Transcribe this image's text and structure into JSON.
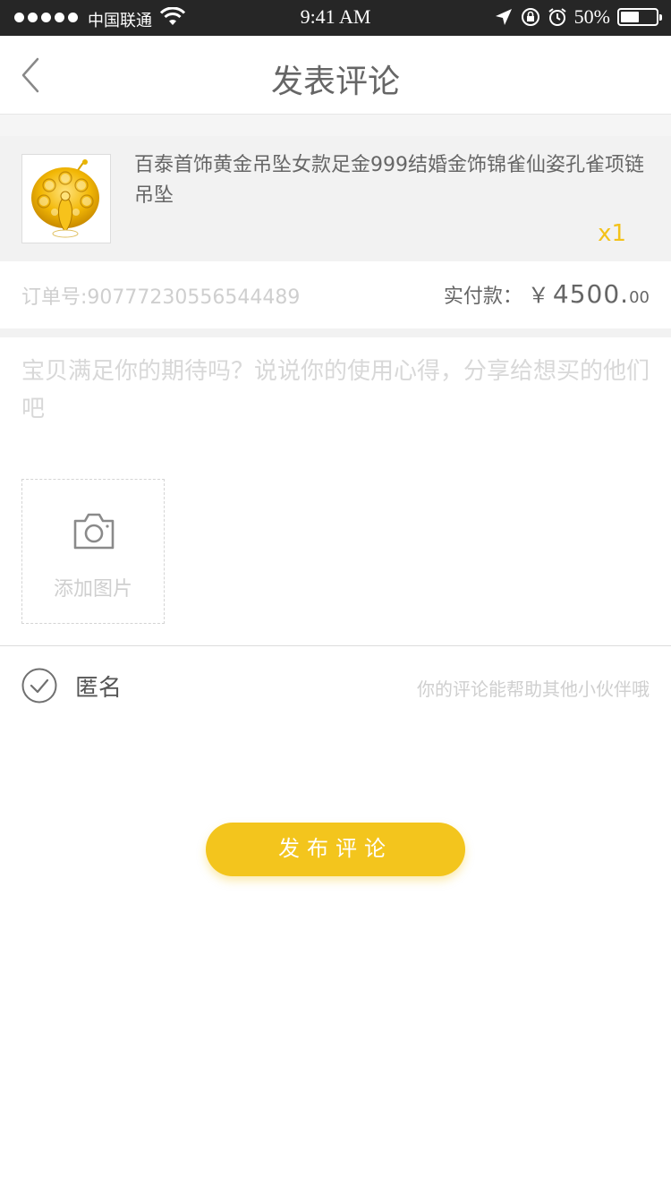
{
  "status_bar": {
    "carrier": "中国联通",
    "time": "9:41 AM",
    "battery": "50%",
    "battery_level": 0.5
  },
  "nav": {
    "title": "发表评论",
    "back_icon": "chevron-left-icon"
  },
  "product": {
    "name": "百泰首饰黄金吊坠女款足金999结婚金饰锦雀仙姿孔雀项链吊坠",
    "quantity": "x1",
    "image_icon": "gold-peacock-pendant-image"
  },
  "order": {
    "order_no": "订单号:90777230556544489",
    "pay_label": "实付款：",
    "currency": "￥",
    "amount_int": "4500.",
    "amount_dec": "00"
  },
  "review": {
    "placeholder": "宝贝满足你的期待吗？说说你的使用心得，分享给想买的他们吧",
    "add_photo_label": "添加图片"
  },
  "anonymous": {
    "label": "匿名",
    "hint": "你的评论能帮助其他小伙伴哦",
    "checked": true
  },
  "submit": {
    "label": "发布评论"
  },
  "colors": {
    "accent": "#f3c51d",
    "quantity": "#f3c21a",
    "status_bar": "#262626"
  }
}
